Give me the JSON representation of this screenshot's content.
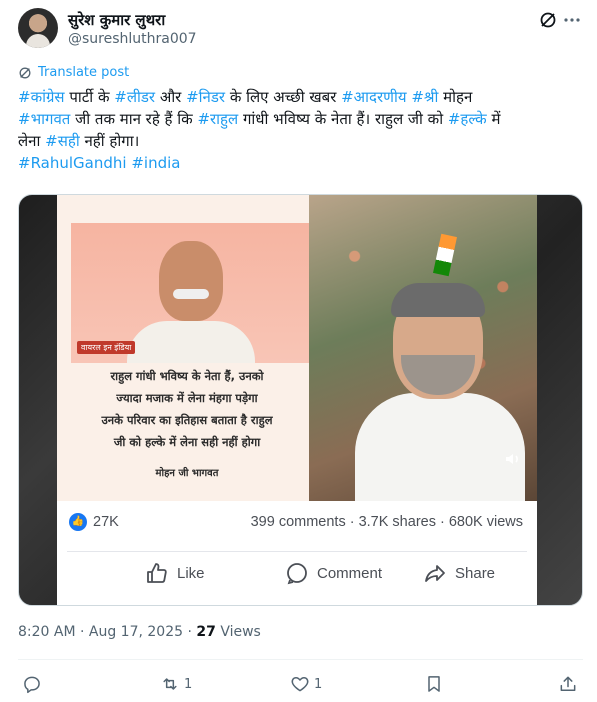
{
  "author": {
    "name": "सुरेश कुमार लुथरा",
    "handle": "@sureshluthra007"
  },
  "translate_label": "Translate post",
  "tweet_text": {
    "line1": [
      {
        "text": "#कांग्रेस",
        "tag": true
      },
      {
        "text": " पार्टी के ",
        "tag": false
      },
      {
        "text": "#लीडर",
        "tag": true
      },
      {
        "text": " और ",
        "tag": false
      },
      {
        "text": "#निडर",
        "tag": true
      },
      {
        "text": " के लिए अच्छी खबर ",
        "tag": false
      },
      {
        "text": "#आदरणीय",
        "tag": true
      },
      {
        "text": " ",
        "tag": false
      },
      {
        "text": "#श्री",
        "tag": true
      },
      {
        "text": " मोहन",
        "tag": false
      }
    ],
    "line2": [
      {
        "text": "#भागवत",
        "tag": true
      },
      {
        "text": " जी तक मान रहे हैं कि ",
        "tag": false
      },
      {
        "text": "#राहुल",
        "tag": true
      },
      {
        "text": " गांधी भविष्य के नेता हैं। राहुल जी को ",
        "tag": false
      },
      {
        "text": "#हल्के",
        "tag": true
      },
      {
        "text": " में",
        "tag": false
      }
    ],
    "line3": [
      {
        "text": "लेना ",
        "tag": false
      },
      {
        "text": "#सही",
        "tag": true
      },
      {
        "text": " नहीं होगा।",
        "tag": false
      }
    ],
    "line4": [
      {
        "text": "#RahulGandhi",
        "tag": true
      },
      {
        "text": " ",
        "tag": false
      },
      {
        "text": "#india",
        "tag": true
      }
    ]
  },
  "media": {
    "source_label": "वायरल इन इंडिया",
    "quote_lines": [
      "राहुल गांधी भविष्य के नेता हैं, उनको",
      "ज्यादा मजाक में लेना मंहगा पड़ेगा",
      "उनके परिवार का इतिहास बताता है राहुल",
      "जी को हल्के में लेना सही नहीं होगा"
    ],
    "quote_author": "मोहन जी भागवत",
    "fb_likes": "27K",
    "fb_counts": "399 comments · 3.7K shares · 680K views",
    "fb_actions": {
      "like": "Like",
      "comment": "Comment",
      "share": "Share"
    }
  },
  "timestamp": {
    "time": "8:20 AM · Aug 17, 2025 · ",
    "views_count": "27",
    "views_label": " Views"
  },
  "action_bar": {
    "reply_count": "",
    "repost_count": "1",
    "like_count": "1"
  },
  "icons": [
    "avatar",
    "no-edit-icon",
    "more-icon",
    "translate-icon",
    "volume-icon",
    "fb-like-badge-icon",
    "thumb-icon",
    "comment-icon",
    "share-icon",
    "reply-icon",
    "repost-icon",
    "heart-icon",
    "bookmark-icon",
    "upload-icon"
  ],
  "colors": {
    "link": "#1d9bf0",
    "text": "#0f1419",
    "muted": "#536471",
    "fb_blue": "#1877f2"
  }
}
